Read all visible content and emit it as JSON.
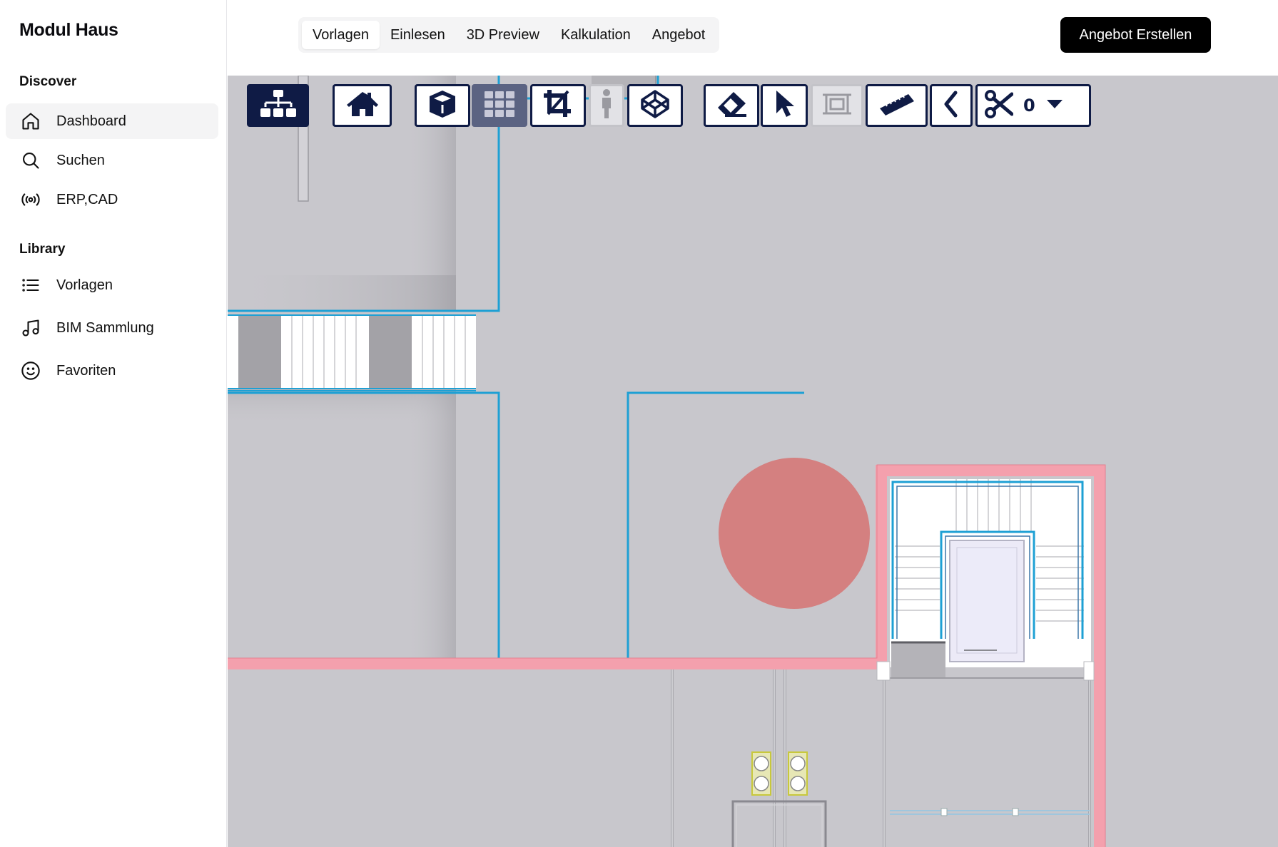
{
  "app": {
    "title": "Modul Haus"
  },
  "sidebar": {
    "sections": [
      {
        "title": "Discover"
      },
      {
        "title": "Library"
      }
    ],
    "items": [
      {
        "label": "Dashboard",
        "icon": "home-icon",
        "active": true
      },
      {
        "label": "Suchen",
        "icon": "search-icon"
      },
      {
        "label": "ERP,CAD",
        "icon": "broadcast-icon"
      },
      {
        "label": "Vorlagen",
        "icon": "list-icon"
      },
      {
        "label": "BIM Sammlung",
        "icon": "music-note-icon"
      },
      {
        "label": "Favoriten",
        "icon": "smiley-icon"
      }
    ]
  },
  "header": {
    "tabs": [
      {
        "label": "Vorlagen",
        "active": true
      },
      {
        "label": "Einlesen"
      },
      {
        "label": "3D Preview"
      },
      {
        "label": "Kalkulation"
      },
      {
        "label": "Angebot"
      }
    ],
    "cta_label": "Angebot Erstellen"
  },
  "toolbar": {
    "tools": [
      {
        "icon": "hierarchy-icon",
        "state": "active"
      },
      {
        "icon": "home-icon"
      },
      {
        "icon": "cube-icon"
      },
      {
        "icon": "grid-icon",
        "state": "selected"
      },
      {
        "icon": "crop-icon"
      },
      {
        "icon": "person-icon",
        "state": "disabled"
      },
      {
        "icon": "codepen-icon"
      },
      {
        "icon": "eraser-icon"
      },
      {
        "icon": "pointer-icon"
      },
      {
        "icon": "frame-icon",
        "state": "disabled"
      },
      {
        "icon": "ruler-icon"
      },
      {
        "icon": "chevron-left-icon"
      },
      {
        "icon": "scissors-icon"
      }
    ],
    "cut_count": "0"
  },
  "colors": {
    "viewer_bg": "#c8c7cc",
    "toolbar_dark": "#0f1b45",
    "wall_blue": "#1ea0d4",
    "wall_pink": "#f4a0ad",
    "marker_red": "#d48080",
    "cta_bg": "#000000"
  }
}
